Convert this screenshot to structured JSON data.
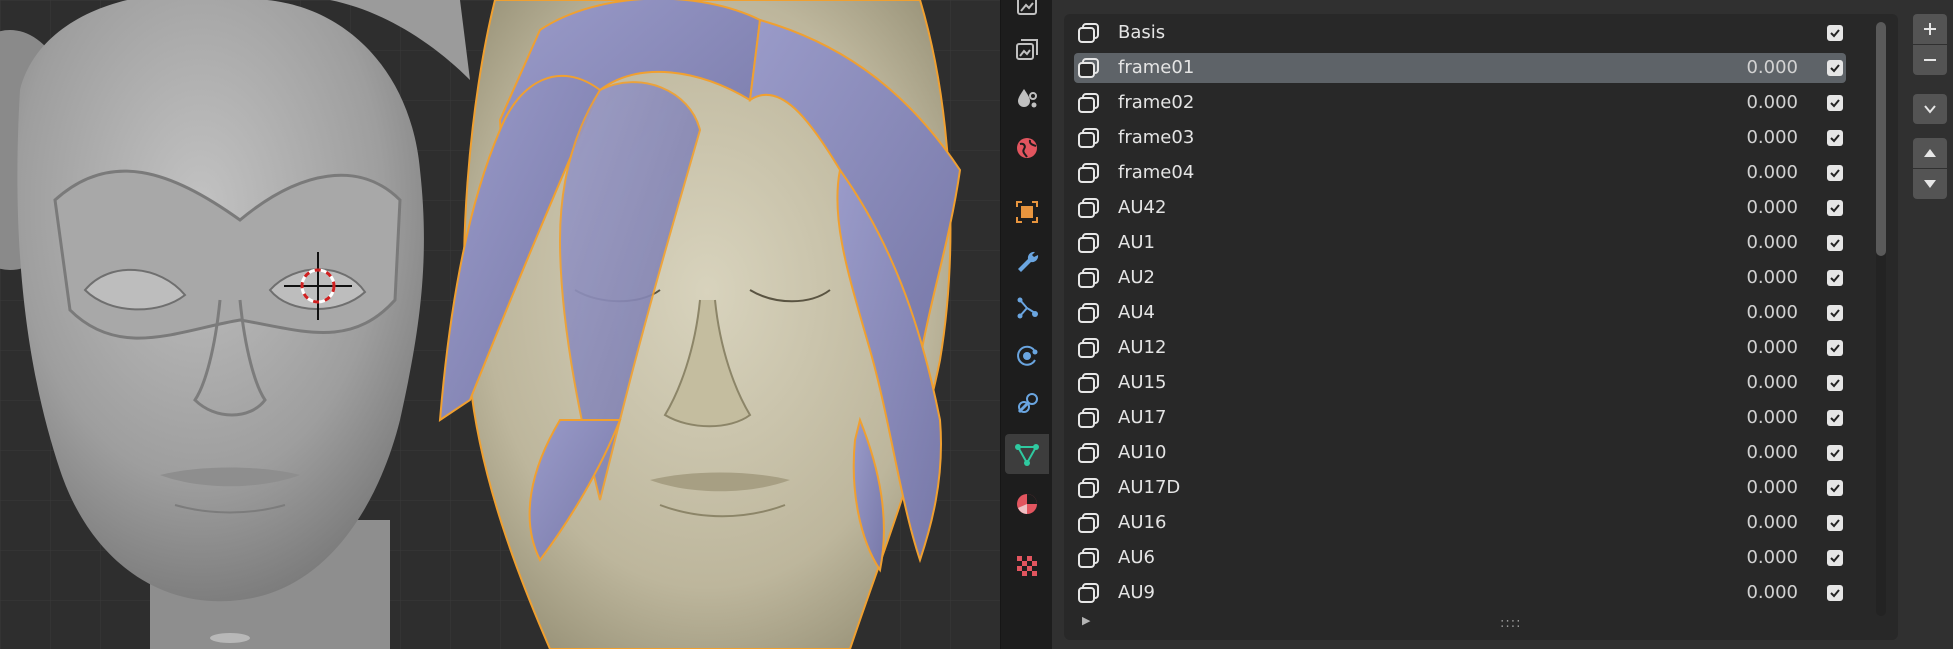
{
  "window": {
    "app": "Blender"
  },
  "viewport": {
    "content": "3D viewport with two head meshes"
  },
  "properties_tabs": [
    {
      "name": "output-icon",
      "color": "#c0c0c0"
    },
    {
      "name": "view-layer-icon",
      "color": "#c0c0c0"
    },
    {
      "name": "scene-icon",
      "color": "#c0c0c0"
    },
    {
      "name": "world-icon",
      "color": "#e2555f"
    },
    {
      "name": "object-icon",
      "color": "#e8953e"
    },
    {
      "name": "modifier-icon",
      "color": "#6aa5e0"
    },
    {
      "name": "particles-icon",
      "color": "#6aa5e0"
    },
    {
      "name": "physics-icon",
      "color": "#6aa5e0"
    },
    {
      "name": "constraints-icon",
      "color": "#6aa5e0"
    },
    {
      "name": "data-icon",
      "color": "#2fc9a0",
      "active": true
    },
    {
      "name": "material-icon",
      "color": "#e2555f"
    },
    {
      "name": "texture-icon",
      "color": "#e2555f"
    }
  ],
  "shape_keys": [
    {
      "name": "Basis",
      "value": "",
      "checked": true,
      "selected": false
    },
    {
      "name": "frame01",
      "value": "0.000",
      "checked": true,
      "selected": true
    },
    {
      "name": "frame02",
      "value": "0.000",
      "checked": true,
      "selected": false
    },
    {
      "name": "frame03",
      "value": "0.000",
      "checked": true,
      "selected": false
    },
    {
      "name": "frame04",
      "value": "0.000",
      "checked": true,
      "selected": false
    },
    {
      "name": "AU42",
      "value": "0.000",
      "checked": true,
      "selected": false
    },
    {
      "name": "AU1",
      "value": "0.000",
      "checked": true,
      "selected": false
    },
    {
      "name": "AU2",
      "value": "0.000",
      "checked": true,
      "selected": false
    },
    {
      "name": "AU4",
      "value": "0.000",
      "checked": true,
      "selected": false
    },
    {
      "name": "AU12",
      "value": "0.000",
      "checked": true,
      "selected": false
    },
    {
      "name": "AU15",
      "value": "0.000",
      "checked": true,
      "selected": false
    },
    {
      "name": "AU17",
      "value": "0.000",
      "checked": true,
      "selected": false
    },
    {
      "name": "AU10",
      "value": "0.000",
      "checked": true,
      "selected": false
    },
    {
      "name": "AU17D",
      "value": "0.000",
      "checked": true,
      "selected": false
    },
    {
      "name": "AU16",
      "value": "0.000",
      "checked": true,
      "selected": false
    },
    {
      "name": "AU6",
      "value": "0.000",
      "checked": true,
      "selected": false
    },
    {
      "name": "AU9",
      "value": "0.000",
      "checked": true,
      "selected": false
    }
  ],
  "list_footer": {
    "expand_arrow": "▶",
    "grip": "::::"
  },
  "side_buttons": {
    "add": "add-shape-key",
    "remove": "remove-shape-key",
    "specials": "shape-key-specials",
    "move_up": "move-up",
    "move_down": "move-down"
  }
}
